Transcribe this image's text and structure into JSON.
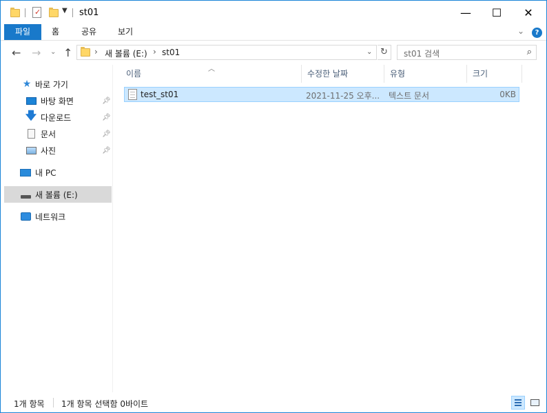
{
  "window": {
    "title": "st01",
    "controls": {
      "minimize": "—",
      "maximize": "☐",
      "close": "✕"
    }
  },
  "ribbon": {
    "tabs": [
      {
        "label": "파일"
      },
      {
        "label": "홈"
      },
      {
        "label": "공유"
      },
      {
        "label": "보기"
      }
    ],
    "expand_glyph": "⌄",
    "help_glyph": "?"
  },
  "address": {
    "crumbs": [
      "새 볼륨 (E:)",
      "st01"
    ],
    "search_placeholder": "st01 검색"
  },
  "nav_pane": {
    "quick_access": "바로 가기",
    "quick_items": [
      {
        "label": "바탕 화면",
        "icon": "desktop-icon"
      },
      {
        "label": "다운로드",
        "icon": "download-icon"
      },
      {
        "label": "문서",
        "icon": "documents-icon"
      },
      {
        "label": "사진",
        "icon": "pictures-icon"
      }
    ],
    "this_pc": "내 PC",
    "volume": "새 볼륨 (E:)",
    "network": "네트워크"
  },
  "columns": [
    "이름",
    "수정한 날짜",
    "유형",
    "크기"
  ],
  "files": [
    {
      "name": "test_st01",
      "modified": "2021-11-25 오후...",
      "type": "텍스트 문서",
      "size": "0KB"
    }
  ],
  "status": {
    "items_count": "1개 항목",
    "selection": "1개 항목 선택함 0바이트"
  },
  "colors": {
    "accent": "#1979ca",
    "selection_bg": "#cce8ff",
    "selection_border": "#99d1ff",
    "nav_selected": "#d9d9d9",
    "folder": "#ffd767"
  }
}
